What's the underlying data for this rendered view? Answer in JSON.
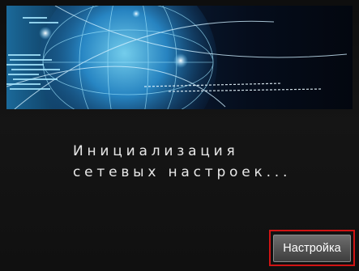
{
  "screen": {
    "message_line1": "Инициализация",
    "message_line2": "сетевых настроек...",
    "settings_button_label": "Настройка"
  },
  "banner": {
    "icon": "network-globe-image"
  },
  "colors": {
    "background": "#121212",
    "highlight_frame": "#d01414",
    "button": "#555555"
  }
}
